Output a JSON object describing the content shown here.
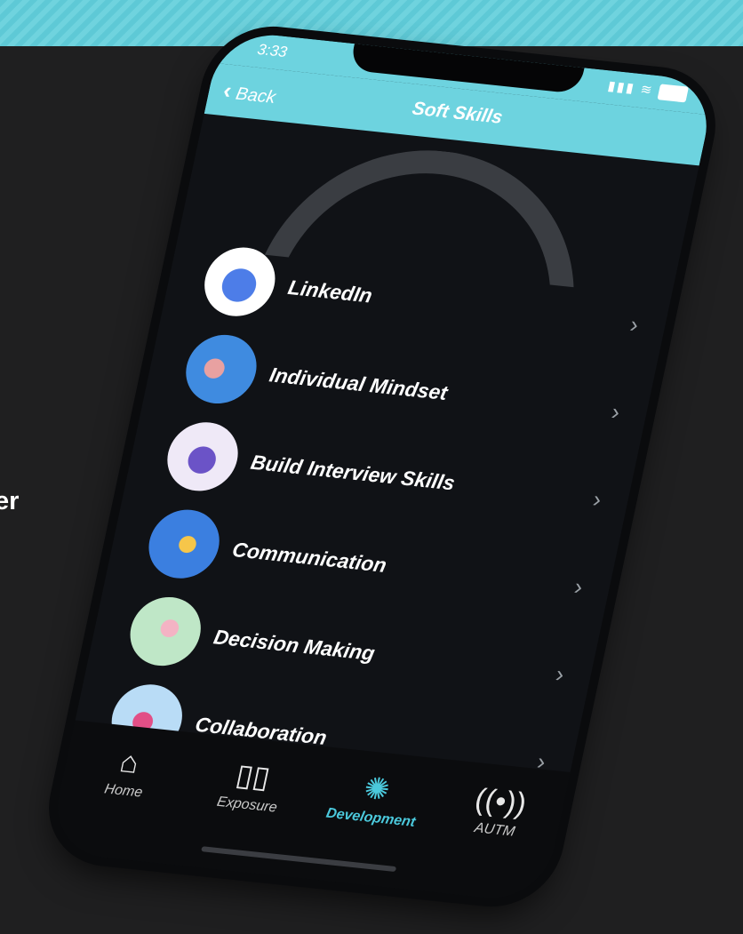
{
  "background": {
    "side_text": "er",
    "stripe_color": "#5ec9d6"
  },
  "status_bar": {
    "time": "3:33",
    "signal": "▮▮▮",
    "wifi": "wifi"
  },
  "nav": {
    "back_label": "Back",
    "title": "Soft Skills",
    "accent": "#6dd3df"
  },
  "skills": [
    {
      "label": "LinkedIn",
      "icon": "linkedin-illustration-icon"
    },
    {
      "label": "Individual Mindset",
      "icon": "mindset-illustration-icon"
    },
    {
      "label": "Build Interview Skills",
      "icon": "interview-illustration-icon"
    },
    {
      "label": "Communication",
      "icon": "communication-illustration-icon"
    },
    {
      "label": "Decision Making",
      "icon": "decision-illustration-icon"
    },
    {
      "label": "Collaboration",
      "icon": "collaboration-illustration-icon"
    }
  ],
  "tabs": [
    {
      "label": "Home",
      "icon": "home-icon",
      "active": false
    },
    {
      "label": "Exposure",
      "icon": "book-icon",
      "active": false
    },
    {
      "label": "Development",
      "icon": "brain-icon",
      "active": true
    },
    {
      "label": "AUTM",
      "icon": "broadcast-icon",
      "active": false
    }
  ],
  "colors": {
    "active_tab": "#4bc9dc",
    "screen_bg": "#101216"
  }
}
